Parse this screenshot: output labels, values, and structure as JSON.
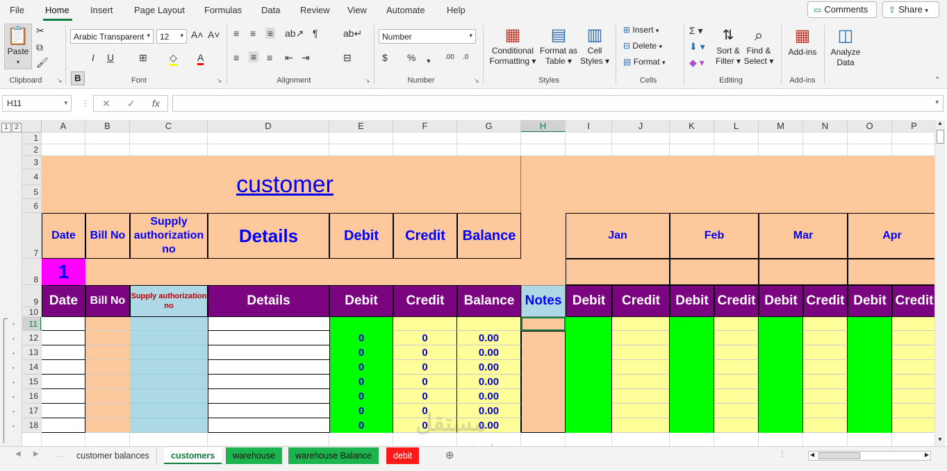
{
  "menu": {
    "tabs": [
      "File",
      "Home",
      "Insert",
      "Page Layout",
      "Formulas",
      "Data",
      "Review",
      "View",
      "Automate",
      "Help"
    ],
    "comments": "Comments",
    "share": "Share"
  },
  "ribbon": {
    "paste": "Paste",
    "font_name": "Arabic Transparent",
    "font_size": "12",
    "number_format": "Number",
    "conditional_formatting": [
      "Conditional",
      "Formatting"
    ],
    "format_as_table": [
      "Format as",
      "Table"
    ],
    "cell_styles": [
      "Cell",
      "Styles"
    ],
    "insert": "Insert",
    "delete": "Delete",
    "format": "Format",
    "sort_filter": [
      "Sort &",
      "Filter"
    ],
    "find_select": [
      "Find &",
      "Select"
    ],
    "add_ins": "Add-ins",
    "analyze": [
      "Analyze",
      "Data"
    ],
    "groups": [
      "Clipboard",
      "Font",
      "Alignment",
      "Number",
      "Styles",
      "Cells",
      "Editing",
      "Add-ins"
    ]
  },
  "formula_bar": {
    "name_box": "H11",
    "value": ""
  },
  "grid": {
    "columns": [
      "A",
      "B",
      "C",
      "D",
      "E",
      "F",
      "G",
      "H",
      "I",
      "J",
      "K",
      "L",
      "M",
      "N",
      "O",
      "P"
    ],
    "rows": [
      "1",
      "2",
      "3",
      "4",
      "5",
      "6",
      "7",
      "8",
      "9",
      "10",
      "11",
      "12",
      "13",
      "14",
      "15",
      "16",
      "17",
      "18"
    ],
    "title": "customer",
    "header_row7": [
      "Date",
      "Bill No",
      "Supply authorization no",
      "Details",
      "Debit",
      "Credit",
      "Balance"
    ],
    "months": [
      "Jan",
      "Feb",
      "Mar",
      "Apr"
    ],
    "row8_value": "1",
    "header_row9": [
      "Date",
      "Bill No",
      "Supply authorization no",
      "Details",
      "Debit",
      "Credit",
      "Balance",
      "Notes"
    ],
    "month_headers": [
      "Debit",
      "Credit",
      "Debit",
      "Credit",
      "Debit",
      "Credit",
      "Debit",
      "Credit"
    ],
    "data_rows": [
      {
        "debit": "0",
        "credit": "0",
        "balance": "0.00"
      },
      {
        "debit": "0",
        "credit": "0",
        "balance": "0.00"
      },
      {
        "debit": "0",
        "credit": "0",
        "balance": "0.00"
      },
      {
        "debit": "0",
        "credit": "0",
        "balance": "0.00"
      },
      {
        "debit": "0",
        "credit": "0",
        "balance": "0.00"
      },
      {
        "debit": "0",
        "credit": "0",
        "balance": "0.00"
      },
      {
        "debit": "0",
        "credit": "0",
        "balance": "0.00"
      }
    ]
  },
  "sheets": [
    "customer balances",
    "customers",
    "warehouse",
    "warehouse Balance",
    "debit"
  ],
  "watermark": {
    "arabic": "مستقل",
    "latin": "mostaql.com"
  }
}
